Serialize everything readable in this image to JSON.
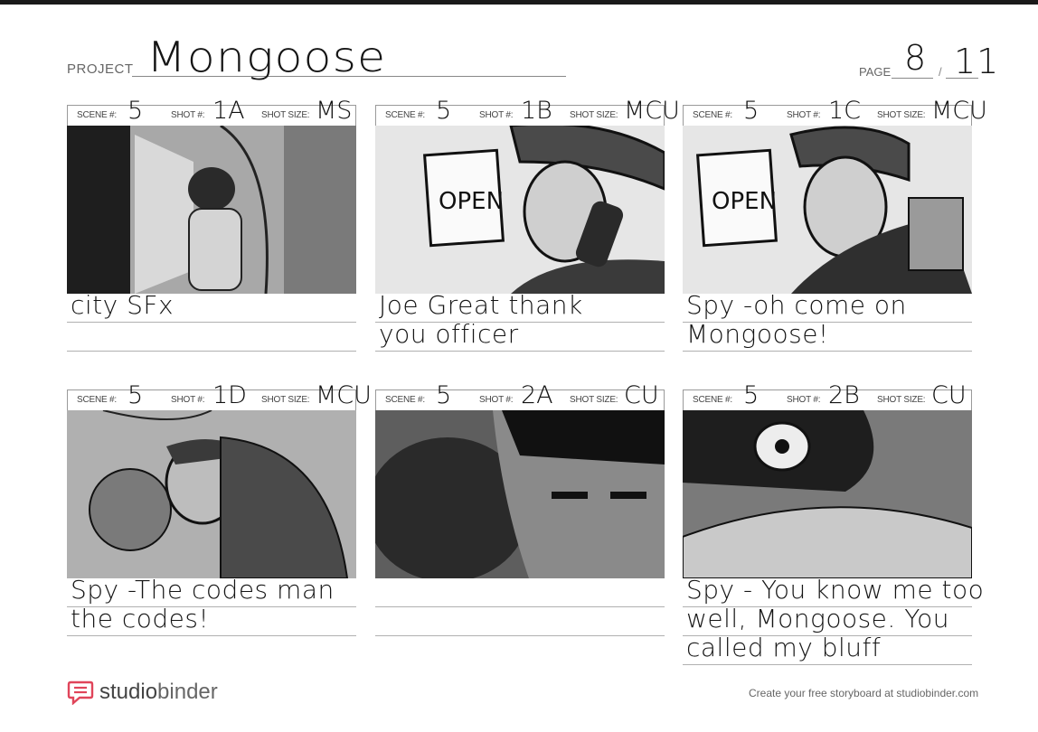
{
  "header": {
    "project_label": "PROJECT",
    "project_name": "Mongoose",
    "page_label": "PAGE",
    "page_current": "8",
    "page_sep": "/",
    "page_total": "11"
  },
  "labels": {
    "scene": "SCENE #:",
    "shot": "SHOT #:",
    "shot_size": "SHOT SIZE:"
  },
  "panels": [
    {
      "scene": "5",
      "shot": "1A",
      "size": "MS",
      "caption_lines": [
        "city SFx",
        ""
      ]
    },
    {
      "scene": "5",
      "shot": "1B",
      "size": "MCU",
      "caption_lines": [
        "Joe Great thank",
        "you officer"
      ]
    },
    {
      "scene": "5",
      "shot": "1C",
      "size": "MCU",
      "caption_lines": [
        "Spy -oh come on",
        "Mongoose!"
      ]
    },
    {
      "scene": "5",
      "shot": "1D",
      "size": "MCU",
      "caption_lines": [
        "Spy -The codes man",
        "the codes!"
      ]
    },
    {
      "scene": "5",
      "shot": "2A",
      "size": "CU",
      "caption_lines": [
        "",
        ""
      ]
    },
    {
      "scene": "5",
      "shot": "2B",
      "size": "CU",
      "caption_lines": [
        "Spy - You know me too",
        "well, Mongoose. You",
        "called my bluff"
      ]
    }
  ],
  "sketch_text": {
    "open_sign": "OPEN"
  },
  "footer": {
    "brand_a": "studio",
    "brand_b": "binder",
    "note": "Create your free storyboard at studiobinder.com"
  },
  "icons": [
    "studiobinder-logo-icon"
  ]
}
